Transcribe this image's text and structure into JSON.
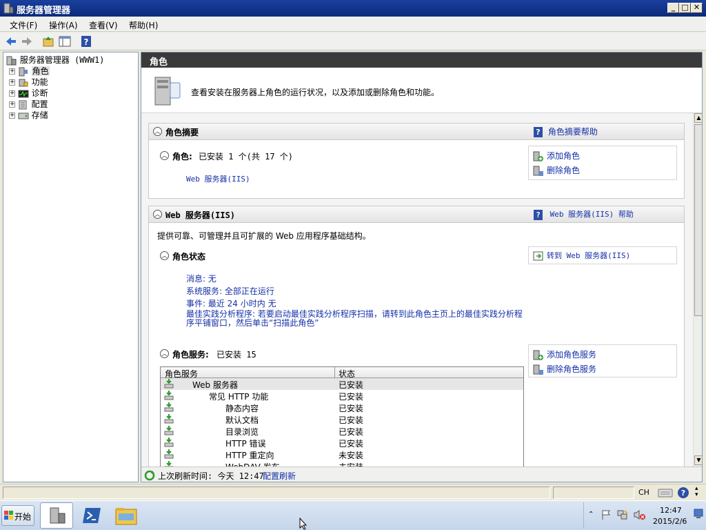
{
  "window": {
    "title": "服务器管理器",
    "controls": [
      "_",
      "□",
      "✕"
    ]
  },
  "menu": [
    "文件(F)",
    "操作(A)",
    "查看(V)",
    "帮助(H)"
  ],
  "tree": {
    "root": "服务器管理器 (WWW1)",
    "items": [
      {
        "label": "角色",
        "icon": "roles-icon",
        "selected": true
      },
      {
        "label": "功能",
        "icon": "features-icon"
      },
      {
        "label": "诊断",
        "icon": "diagnostics-icon"
      },
      {
        "label": "配置",
        "icon": "configuration-icon"
      },
      {
        "label": "存储",
        "icon": "storage-icon"
      }
    ]
  },
  "main": {
    "header": "角色",
    "intro": "查看安装在服务器上角色的运行状况，以及添加或删除角色和功能。",
    "roles_summary": {
      "title": "角色摘要",
      "help": "角色摘要帮助",
      "roles_label": "角色:",
      "roles_value": "已安装 1 个(共 17 个)",
      "installed_role": "Web 服务器(IIS)",
      "actions": [
        "添加角色",
        "删除角色"
      ]
    },
    "web_server": {
      "title": "Web 服务器(IIS)",
      "help": "Web 服务器(IIS) 帮助",
      "description": "提供可靠、可管理并且可扩展的 Web 应用程序基础结构。",
      "status_title": "角色状态",
      "goto_action": "转到 Web 服务器(IIS)",
      "status_lines": [
        "消息: 无",
        "系统服务: 全部正在运行",
        "事件: 最近 24 小时内 无",
        "最佳实践分析程序: 若要启动最佳实践分析程序扫描，请转到此角色主页上的最佳实践分析程序平铺窗口，然后单击“扫描此角色”"
      ],
      "services_title": "角色服务:",
      "services_value": "已安装 15",
      "services_actions": [
        "添加角色服务",
        "删除角色服务"
      ],
      "table_headers": [
        "角色服务",
        "状态"
      ],
      "table_rows": [
        {
          "name": "Web 服务器",
          "status": "已安装",
          "indent": 0
        },
        {
          "name": "常见 HTTP 功能",
          "status": "已安装",
          "indent": 1
        },
        {
          "name": "静态内容",
          "status": "已安装",
          "indent": 2
        },
        {
          "name": "默认文档",
          "status": "已安装",
          "indent": 2
        },
        {
          "name": "目录浏览",
          "status": "已安装",
          "indent": 2
        },
        {
          "name": "HTTP 错误",
          "status": "已安装",
          "indent": 2
        },
        {
          "name": "HTTP 重定向",
          "status": "未安装",
          "indent": 2
        },
        {
          "name": "WebDAV 发布",
          "status": "未安装",
          "indent": 2
        }
      ]
    },
    "refresh": {
      "label": "上次刷新时间: 今天 12:47",
      "link": "配置刷新"
    }
  },
  "statusbar": {
    "lang": "CH"
  },
  "taskbar": {
    "start": "开始",
    "time": "12:47",
    "date": "2015/2/6"
  },
  "colors": {
    "titlebar": "#0d2a7a",
    "link": "#1530a8",
    "header": "#3a3a3a"
  }
}
